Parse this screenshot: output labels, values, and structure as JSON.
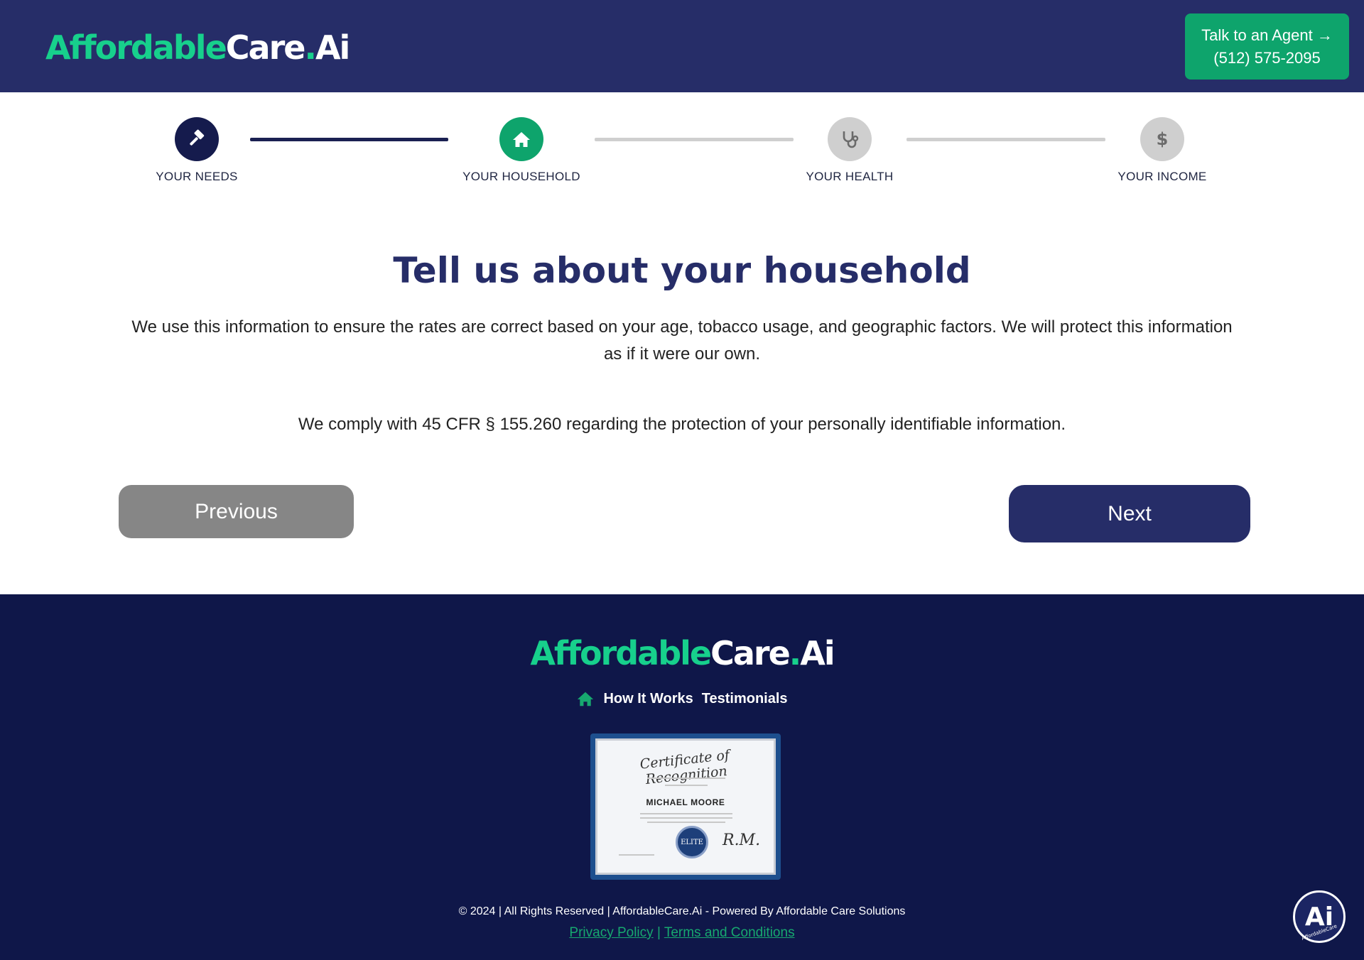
{
  "brand": {
    "part1": "Affordable",
    "part2": "Care",
    "dot": ".",
    "part3": "Ai",
    "colors": {
      "navy": "#262d68",
      "green": "#17d08c",
      "footer": "#0f1749"
    }
  },
  "header": {
    "agent_line1": "Talk to an Agent →",
    "agent_line2": "(512) 575-2095"
  },
  "steps": [
    {
      "label": "YOUR NEEDS",
      "icon": "hammer-icon",
      "state": "done"
    },
    {
      "label": "YOUR HOUSEHOLD",
      "icon": "home-icon",
      "state": "active"
    },
    {
      "label": "YOUR HEALTH",
      "icon": "stethoscope-icon",
      "state": "pending"
    },
    {
      "label": "YOUR INCOME",
      "icon": "dollar-icon",
      "state": "pending"
    }
  ],
  "main": {
    "title": "Tell us about your household",
    "description": "We use this information to ensure the rates are correct based on your age, tobacco usage, and geographic factors. We will protect this information as if it were our own.",
    "compliance": "We comply with 45 CFR § 155.260 regarding the protection of your personally identifiable information.",
    "previous_label": "Previous",
    "next_label": "Next"
  },
  "footer": {
    "links": [
      "How It Works",
      "Testimonials"
    ],
    "certificate": {
      "title": "Certificate of Recognition",
      "name": "MICHAEL MOORE",
      "seal": "ELITE"
    },
    "copyright": "© 2024 | All Rights Reserved | AffordableCare.Ai - Powered By Affordable Care Solutions",
    "privacy": "Privacy Policy",
    "separator": "|",
    "terms": "Terms and Conditions"
  },
  "badge": {
    "label": "Ai",
    "sub": "AffordableCare"
  }
}
